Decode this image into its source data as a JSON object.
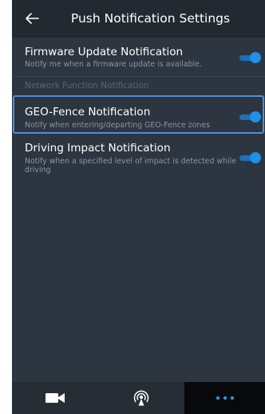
{
  "header": {
    "back_icon": "arrow-left-icon",
    "title": "Push Notification Settings"
  },
  "settings": [
    {
      "title": "Firmware Update Notification",
      "description": "Notify me when a firmware update is available.",
      "enabled": true
    },
    {
      "title": "GEO-Fence Notification",
      "description": "Notify when entering/departing GEO-Fence zones",
      "enabled": true,
      "focused": true
    },
    {
      "title": "Driving Impact Notification",
      "description": "Notify when a specified level of impact is detected while driving",
      "enabled": true
    }
  ],
  "section_label": "Network Function Notification",
  "bottom_nav": [
    {
      "icon": "video-camera-icon",
      "active": false
    },
    {
      "icon": "broadcast-icon",
      "active": false
    },
    {
      "icon": "more-dots-icon",
      "active": true
    }
  ],
  "colors": {
    "accent": "#1f8fe8",
    "background": "#2d3540",
    "header": "#222931",
    "focus_border": "#4b8fd6",
    "more_dots": "#2f8ee6"
  }
}
